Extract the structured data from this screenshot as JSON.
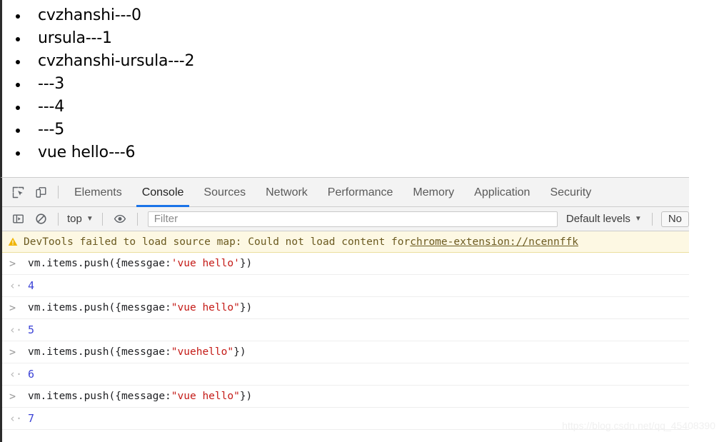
{
  "page": {
    "list_items": [
      "cvzhanshi---0",
      "ursula---1",
      "cvzhanshi-ursula---2",
      "---3",
      "---4",
      "---5",
      "vue hello---6"
    ]
  },
  "devtools": {
    "tabs": [
      {
        "label": "Elements",
        "active": false
      },
      {
        "label": "Console",
        "active": true
      },
      {
        "label": "Sources",
        "active": false
      },
      {
        "label": "Network",
        "active": false
      },
      {
        "label": "Performance",
        "active": false
      },
      {
        "label": "Memory",
        "active": false
      },
      {
        "label": "Application",
        "active": false
      },
      {
        "label": "Security",
        "active": false
      }
    ],
    "toolbar": {
      "inspect_icon": "inspect-element-icon",
      "device_icon": "device-toolbar-icon"
    },
    "filterbar": {
      "sidebar_icon": "console-sidebar-icon",
      "clear_icon": "clear-console-icon",
      "context": "top",
      "context_caret": "▼",
      "eye_icon": "live-expression-icon",
      "filter_placeholder": "Filter",
      "filter_value": "",
      "levels": "Default levels",
      "levels_caret": "▼",
      "issues_button": "No"
    },
    "warning": {
      "icon": "warning-triangle-icon",
      "text_before": "DevTools failed to load source map: Could not load content for ",
      "link": "chrome-extension://ncennffk"
    },
    "console_entries": [
      {
        "prompt": ">",
        "code_before": "vm.items.push({messgae:",
        "string": "'vue hello'",
        "code_after": "})",
        "return_marker": "‹·",
        "return_value": "4"
      },
      {
        "prompt": ">",
        "code_before": "vm.items.push({messgae:",
        "string": "\"vue hello\"",
        "code_after": "})",
        "return_marker": "‹·",
        "return_value": "5"
      },
      {
        "prompt": ">",
        "code_before": "vm.items.push({messgae:",
        "string": "\"vuehello\"",
        "code_after": "})",
        "return_marker": "‹·",
        "return_value": "6"
      },
      {
        "prompt": ">",
        "code_before": "vm.items.push({message:",
        "string": "\"vue hello\"",
        "code_after": "})",
        "return_marker": "‹·",
        "return_value": "7"
      }
    ]
  },
  "watermark": "https://blog.csdn.net/qq_45408390",
  "colors": {
    "accent": "#1a73e8",
    "string": "#c41a16",
    "return_value": "#3b42d6",
    "warning_bg": "#fdf8e3"
  }
}
